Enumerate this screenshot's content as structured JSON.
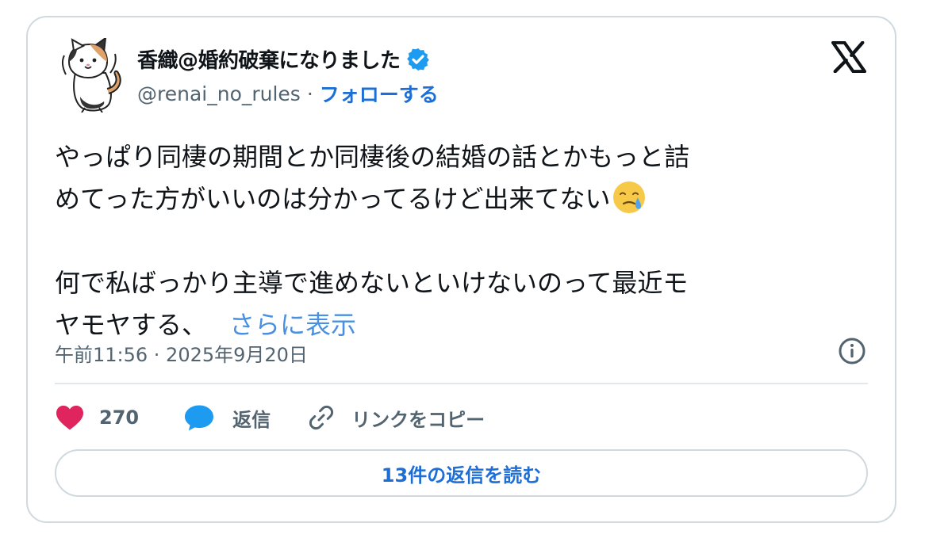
{
  "author": {
    "display_name": "香織@婚約破棄になりました",
    "handle": "@renai_no_rules",
    "separator": "·",
    "follow_label": "フォローする"
  },
  "tweet": {
    "lines": [
      "やっぱり同棲の期間とか同棲後の結婚の話とかもっと詰",
      "めてった方がいいのは分かってるけど出来てない",
      "何で私ばっかり主導で進めないといけないのって最近モ",
      "ヤモヤする、"
    ],
    "emoji": "face-holding-back-tears",
    "show_more_label": "さらに表示"
  },
  "meta": {
    "timestamp": "午前11:56 · 2025年9月20日"
  },
  "actions": {
    "like_count": "270",
    "reply_label": "返信",
    "copy_link_label": "リンクをコピー"
  },
  "read_replies_label": "13件の返信を読む",
  "colors": {
    "accent": "#1d6fd6",
    "show_more": "#4a90e2",
    "like_heart": "#e0245e",
    "reply_bubble": "#1d9bf0",
    "verified": "#1d9bf0",
    "text_secondary": "#536471"
  }
}
